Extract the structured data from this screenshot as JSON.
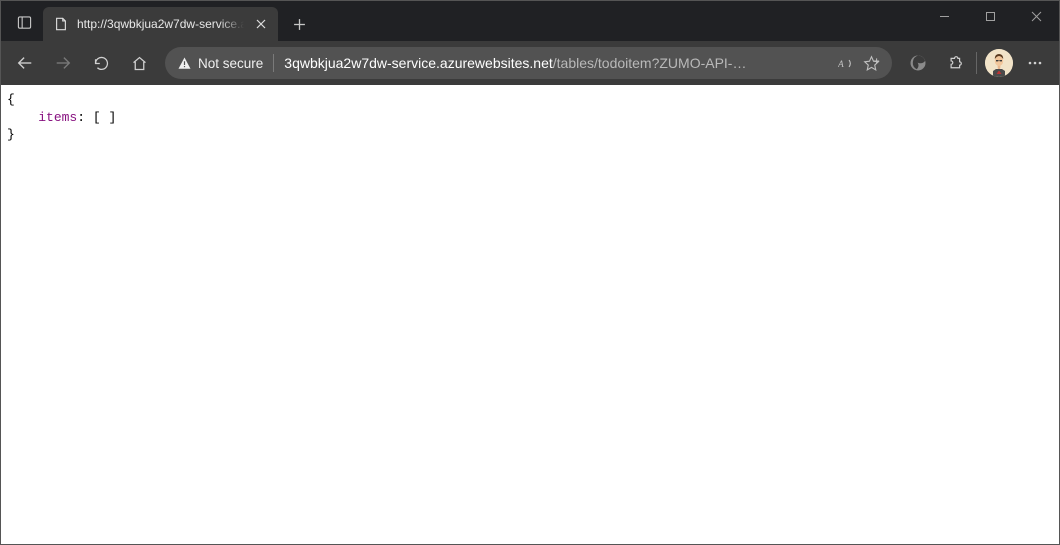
{
  "tab": {
    "title": "http://3qwbkjua2w7dw-service.a"
  },
  "toolbar": {
    "security_label": "Not secure",
    "url_host": "3qwbkjua2w7dw-service.azurewebsites.net",
    "url_path": "/tables/todoitem?ZUMO-API-…"
  },
  "page_body": {
    "brace_open": "{",
    "items_key": "items",
    "items_value": ": [ ]",
    "brace_close": "}"
  }
}
